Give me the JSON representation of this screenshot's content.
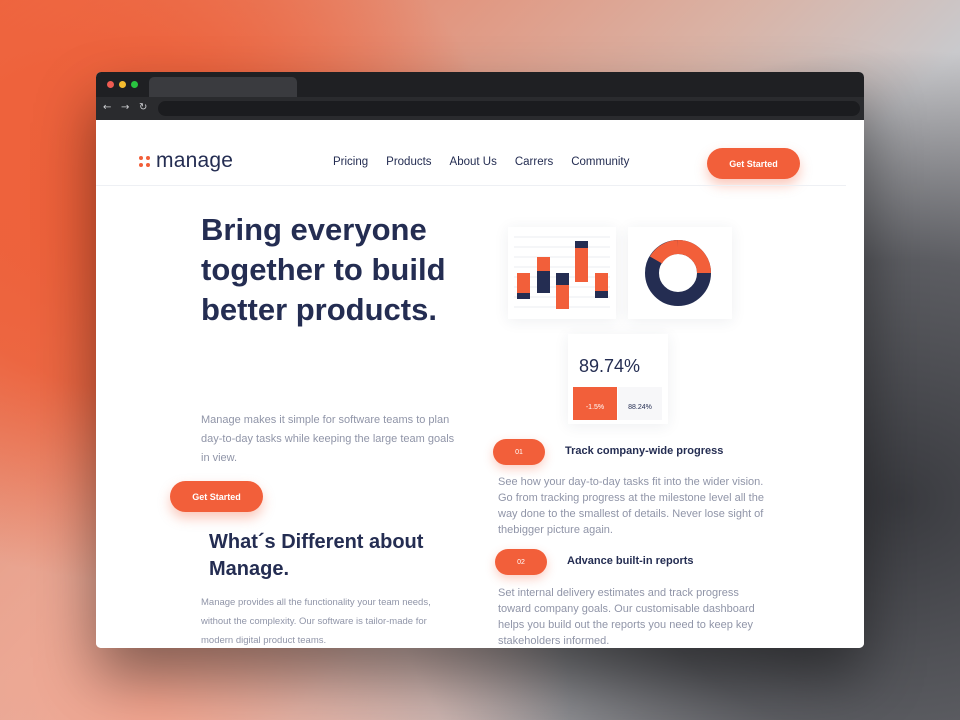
{
  "header": {
    "logo_text": "manage",
    "nav": [
      "Pricing",
      "Products",
      "About Us",
      "Carrers",
      "Community"
    ],
    "cta_label": "Get Started"
  },
  "hero": {
    "title": "Bring everyone together to build better products.",
    "subtitle": "Manage makes it simple for software teams to plan day-to-day tasks while keeping the large team goals in view.",
    "cta_label": "Get Started"
  },
  "stats": {
    "big_value": "89.74%",
    "red_value": "-1.5%",
    "small_value": "88.24%"
  },
  "features": [
    {
      "number": "01",
      "title": "Track company-wide progress",
      "text": "See how your day-to-day tasks fit into the wider vision. Go from tracking progress at the milestone level all the way done to the smallest of details. Never lose sight of thebigger picture again."
    },
    {
      "number": "02",
      "title": "Advance built-in reports",
      "text": "Set internal delivery estimates and track progress toward company goals. Our customisable dashboard helps you build out the reports you need to keep key stakeholders informed."
    }
  ],
  "different": {
    "title": "What´s Different about Manage.",
    "text": "Manage provides all the functionality your team needs, without the complexity. Our software is tailor-made for modern digital product teams."
  },
  "colors": {
    "accent": "#f25f3a",
    "navy": "#242d52",
    "muted": "#9095a8"
  }
}
